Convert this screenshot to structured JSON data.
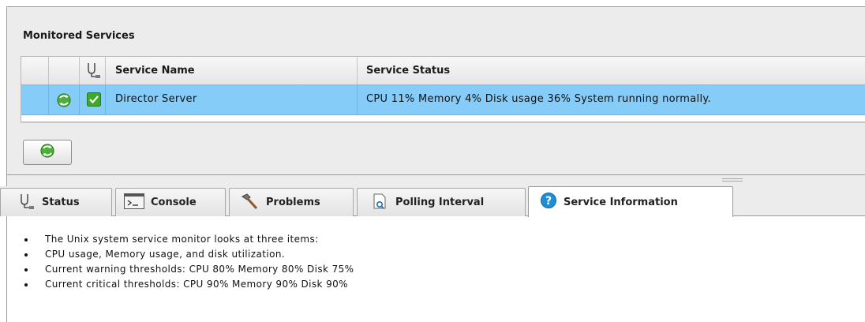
{
  "monitored_services": {
    "title": "Monitored Services",
    "columns": {
      "service_name": "Service Name",
      "service_status": "Service Status"
    },
    "rows": [
      {
        "service_name": "Director Server",
        "service_status": "CPU 11% Memory 4% Disk usage 36% System running normally.",
        "checked": true
      }
    ]
  },
  "tabs": [
    {
      "label": "Status",
      "icon": "stethoscope-icon"
    },
    {
      "label": "Console",
      "icon": "console-icon"
    },
    {
      "label": "Problems",
      "icon": "hammer-icon"
    },
    {
      "label": "Polling Interval",
      "icon": "document-magnifier-icon"
    },
    {
      "label": "Service Information",
      "icon": "help-icon",
      "active": true
    }
  ],
  "service_information": [
    "The Unix system service monitor looks at three items:",
    "CPU usage, Memory usage, and disk utilization.",
    "Current warning thresholds: CPU 80% Memory 80% Disk 75%",
    "Current critical thresholds: CPU 90% Memory 90% Disk 90%"
  ],
  "colors": {
    "selected_row": "#86ccf8",
    "help_icon": "#1e8fd6",
    "check_green": "#3fa82a"
  }
}
